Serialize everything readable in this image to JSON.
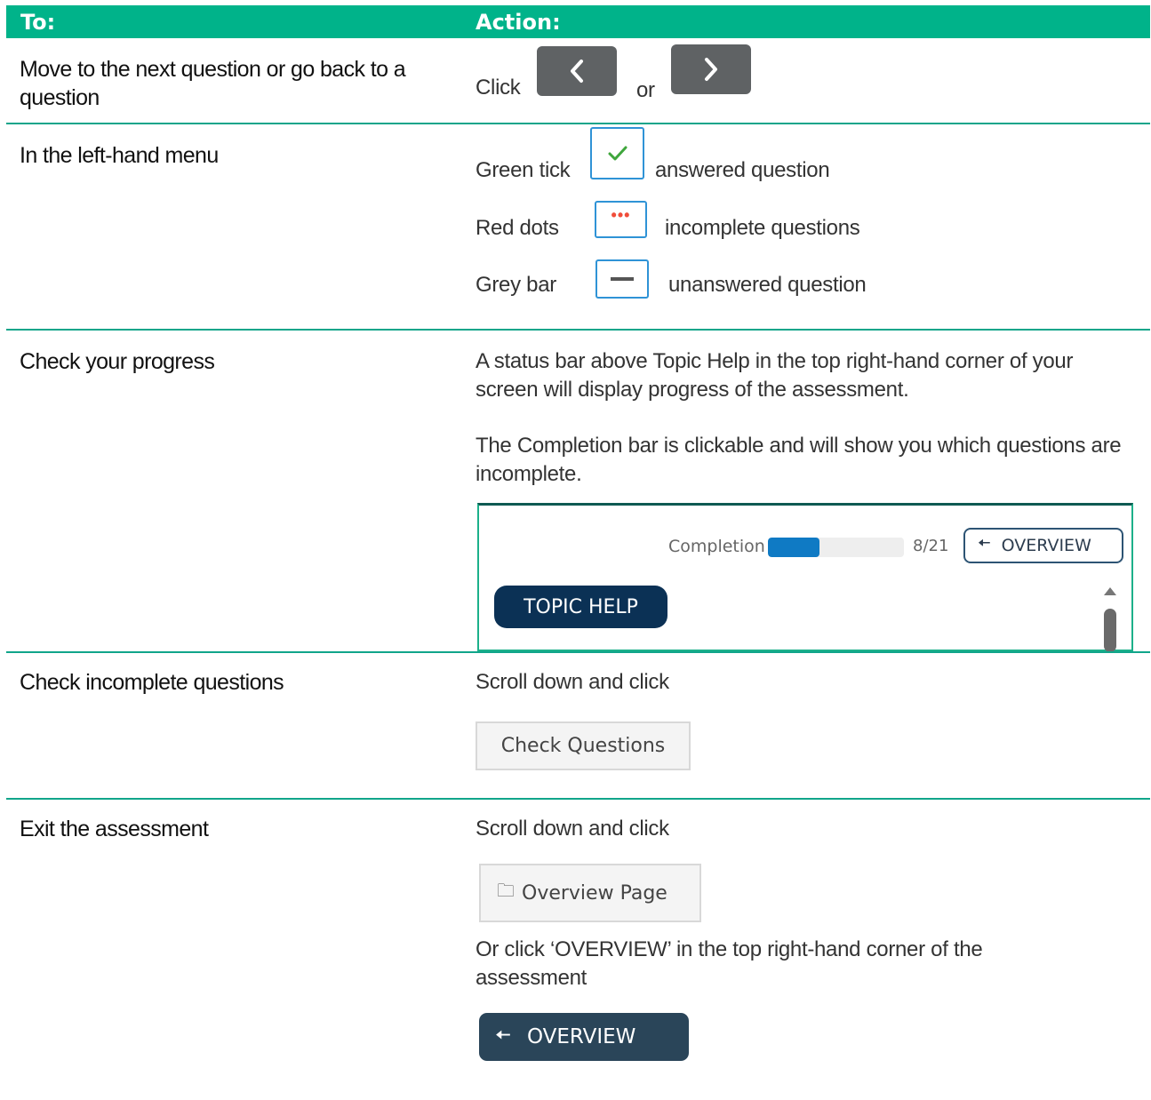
{
  "header": {
    "to": "To:",
    "action": "Action:"
  },
  "rows": {
    "nav": {
      "task": "Move to the next question or go back to a question",
      "click": "Click",
      "or": "or"
    },
    "menu": {
      "task": "In the left-hand menu",
      "tick_label": "Green tick",
      "tick_desc": "answered question",
      "dots_label": "Red dots",
      "dots_desc": "incomplete questions",
      "bar_label": "Grey bar",
      "bar_desc": "unanswered question"
    },
    "progress": {
      "task": "Check your progress",
      "para1": "A status bar above Topic Help in the top right-hand corner of your screen will display progress of the assessment.",
      "para2": "The Completion bar is clickable and will show you which questions are incomplete.",
      "completion_label": "Completion",
      "completion_count": "8/21",
      "completion_fraction": 0.38,
      "overview_btn": "OVERVIEW",
      "topic_help_btn": "TOPIC HELP"
    },
    "incomplete": {
      "task": "Check incomplete questions",
      "instruction": "Scroll down and click",
      "button": "Check Questions"
    },
    "exit": {
      "task": "Exit the assessment",
      "instruction": "Scroll down and click",
      "button": "Overview Page",
      "alt_text": "Or click ‘OVERVIEW’ in the top right-hand corner of the assessment",
      "overview_btn": "OVERVIEW"
    }
  },
  "icons": {
    "prev": "chevron-left-icon",
    "next": "chevron-right-icon",
    "tick": "check-icon",
    "dots": "dots-icon",
    "bar": "dash-icon",
    "arrow": "arrow-left-icon",
    "folder": "folder-icon"
  },
  "colors": {
    "header": "#00b38a",
    "tick": "#3fa63c",
    "dots": "#f04d3a",
    "progress_fill": "#0f7ac4",
    "topic_help": "#0b3155"
  }
}
